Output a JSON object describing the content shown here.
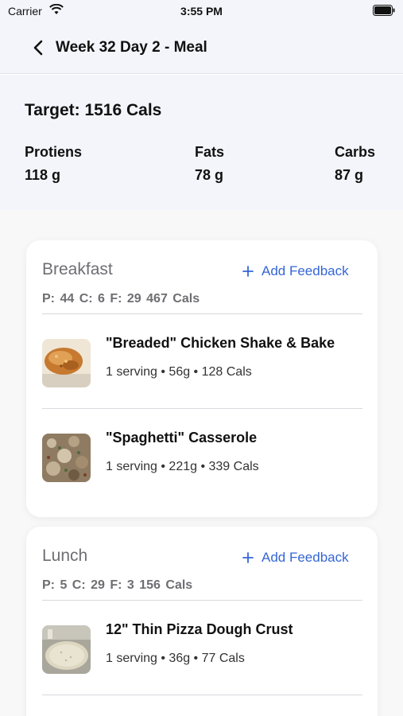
{
  "status_bar": {
    "carrier": "Carrier",
    "time": "3:55 PM"
  },
  "nav": {
    "title": "Week 32 Day 2 - Meal"
  },
  "summary": {
    "target": "Target: 1516 Cals",
    "macros": [
      {
        "label": "Protiens",
        "value": "118 g"
      },
      {
        "label": "Fats",
        "value": "78 g"
      },
      {
        "label": "Carbs",
        "value": "87 g"
      }
    ]
  },
  "meals": [
    {
      "title": "Breakfast",
      "add_feedback_label": "Add Feedback",
      "macros_line": "P: 44  C: 6  F: 29  467 Cals",
      "items": [
        {
          "name": "\"Breaded\" Chicken Shake & Bake",
          "detail": "1 serving • 56g • 128 Cals",
          "image": "breaded-chicken-photo"
        },
        {
          "name": "\"Spaghetti\" Casserole",
          "detail": "1 serving • 221g • 339 Cals",
          "image": "casserole-photo"
        }
      ]
    },
    {
      "title": "Lunch",
      "add_feedback_label": "Add Feedback",
      "macros_line": "P: 5  C: 29  F: 3  156 Cals",
      "items": [
        {
          "name": "12\" Thin Pizza Dough Crust",
          "detail": "1 serving • 36g • 77 Cals",
          "image": "pizza-crust-photo"
        }
      ]
    }
  ],
  "colors": {
    "accent": "#3566d6",
    "header_bg": "#f3f5fa",
    "muted_text": "#6e6e73"
  }
}
